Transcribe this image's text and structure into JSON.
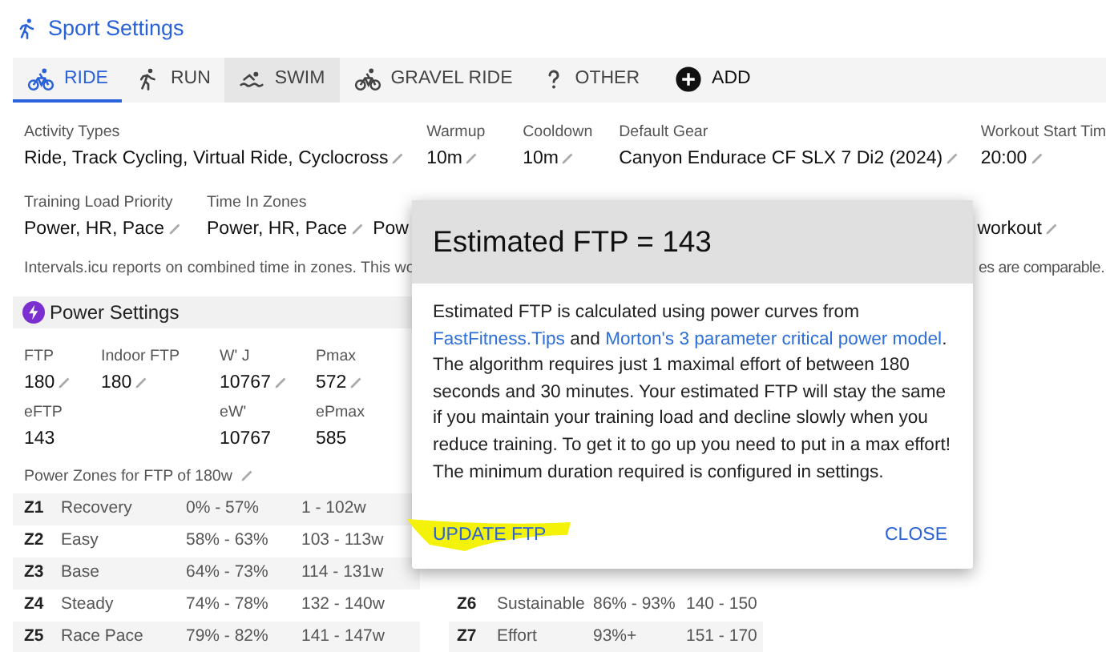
{
  "header": {
    "title": "Sport Settings"
  },
  "tabs": [
    {
      "label": "RIDE",
      "kind": "bike",
      "selected": true,
      "hovered": false
    },
    {
      "label": "RUN",
      "kind": "runner",
      "selected": false,
      "hovered": false
    },
    {
      "label": "SWIM",
      "kind": "swimmer",
      "selected": false,
      "hovered": true
    },
    {
      "label": "GRAVEL RIDE",
      "kind": "bike",
      "selected": false,
      "hovered": false
    },
    {
      "label": "OTHER",
      "kind": "question",
      "selected": false,
      "hovered": false
    },
    {
      "label": "ADD",
      "kind": "add",
      "selected": false,
      "hovered": false
    }
  ],
  "field_rows": [
    {
      "fields": [
        {
          "label": "Activity Types",
          "value": "Ride, Track Cycling, Virtual Ride, Cyclocross",
          "editable": true
        },
        {
          "label": "Warmup",
          "value": "10m",
          "editable": true
        },
        {
          "label": "Cooldown",
          "value": "10m",
          "editable": true
        },
        {
          "label": "Default Gear",
          "value": "Canyon Endurace CF SLX 7 Di2 (2024)",
          "editable": true
        },
        {
          "label": "Workout Start Tim",
          "value": "20:00",
          "editable": true
        }
      ]
    },
    {
      "fields": [
        {
          "label": "Training Load Priority",
          "value": "Power, HR, Pace",
          "editable": true
        },
        {
          "label": "Time In Zones",
          "value": "Power, HR, Pace",
          "editable": true
        },
        {
          "value": "Pow",
          "editable": false
        },
        {
          "value": "workout",
          "editable": true
        }
      ]
    }
  ],
  "note": [
    "Intervals.icu reports on combined time in zones. This wo",
    "es are comparable."
  ],
  "power": {
    "title": "Power Settings",
    "fields": [
      {
        "label": "FTP",
        "value": "180",
        "editable": true
      },
      {
        "label": "Indoor FTP",
        "value": "180",
        "editable": true
      },
      {
        "label": "W' J",
        "value": "10767",
        "editable": true
      },
      {
        "label": "Pmax",
        "value": "572",
        "editable": true
      },
      {
        "label": "eFTP",
        "value": "143",
        "editable": false
      },
      {
        "label": "eW'",
        "value": "10767",
        "editable": false
      },
      {
        "label": "ePmax",
        "value": "585",
        "editable": false
      }
    ],
    "zones_label": "Power Zones for FTP of 180w",
    "zones": [
      {
        "zone": "Z1",
        "name": "Recovery",
        "percent": "0% - 57%",
        "watts": "1 - 102w"
      },
      {
        "zone": "Z2",
        "name": "Easy",
        "percent": "58% - 63%",
        "watts": "103 - 113w"
      },
      {
        "zone": "Z3",
        "name": "Base",
        "percent": "64% - 73%",
        "watts": "114 - 131w"
      },
      {
        "zone": "Z4",
        "name": "Steady",
        "percent": "74% - 78%",
        "watts": "132 - 140w"
      },
      {
        "zone": "Z5",
        "name": "Race Pace",
        "percent": "79% - 82%",
        "watts": "141 - 147w"
      }
    ]
  },
  "other_zones": [
    {
      "zone": "Z6",
      "name": "Sustainable",
      "percent": "86% - 93%",
      "range": "140 - 150"
    },
    {
      "zone": "Z7",
      "name": "Effort",
      "percent": "93%+",
      "range": "151 - 170"
    }
  ],
  "dialog": {
    "title": "Estimated FTP = 143",
    "body": [
      {
        "kind": "text",
        "text": "Estimated FTP is calculated using power curves from "
      },
      {
        "kind": "link",
        "text": "FastFitness.Tips"
      },
      {
        "kind": "text",
        "text": " and "
      },
      {
        "kind": "link",
        "text": "Morton's 3 parameter critical power model"
      },
      {
        "kind": "text",
        "text": ". The algorithm requires just 1 maximal effort of between 180 seconds and 30 minutes. Your estimated FTP will stay the same if you maintain your training load and decline slowly when you reduce training. To get it to go up you need to put in a max effort! The minimum duration required is configured in settings."
      }
    ],
    "buttons": [
      {
        "label": "UPDATE FTP",
        "highlighted": true
      },
      {
        "label": "CLOSE",
        "highlighted": false
      }
    ]
  }
}
